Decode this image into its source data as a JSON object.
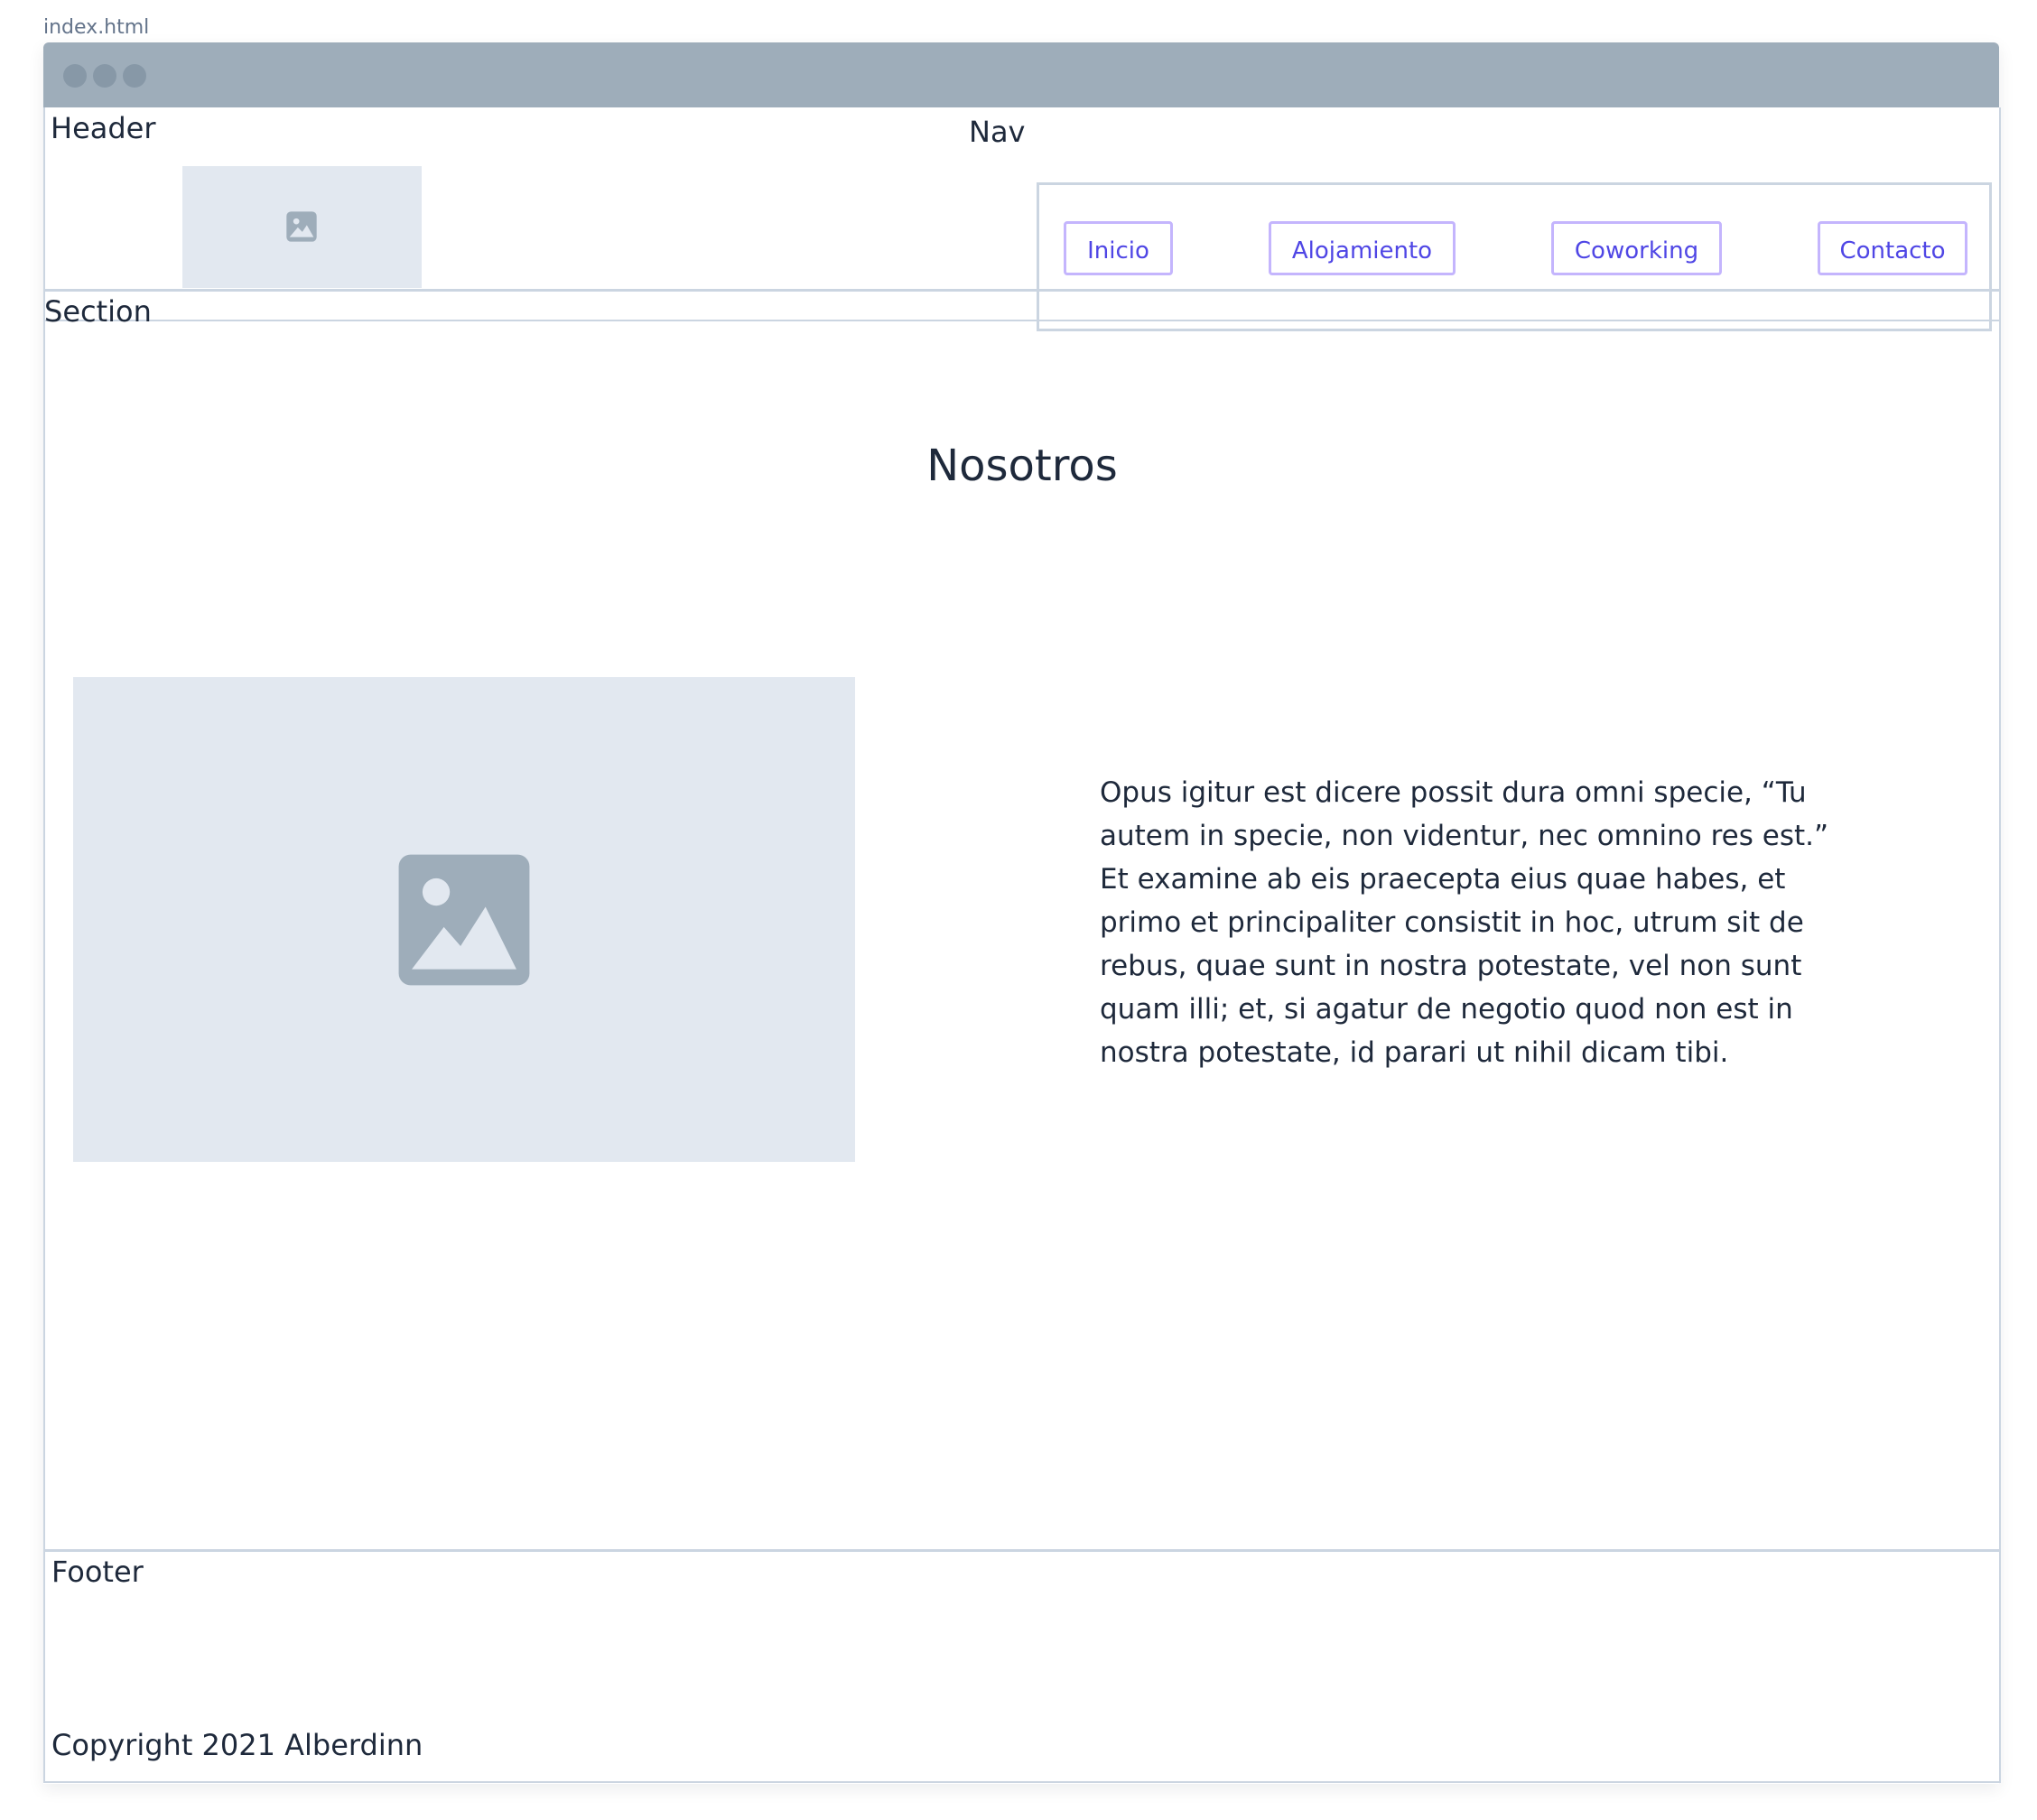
{
  "file_label": "index.html",
  "header": {
    "label": "Header",
    "nav_label": "Nav",
    "nav_items": [
      {
        "label": "Inicio"
      },
      {
        "label": "Alojamiento"
      },
      {
        "label": "Coworking"
      },
      {
        "label": "Contacto"
      }
    ]
  },
  "section": {
    "label": "Section",
    "title": "Nosotros",
    "text": "Opus igitur est dicere possit dura omni specie, “Tu autem in specie, non videntur, nec omnino res est.” Et examine ab eis praecepta eius quae habes, et primo et principaliter consistit in hoc, utrum sit de rebus, quae sunt in nostra potestate, vel non sunt quam illi; et, si agatur de negotio quod non est in nostra potestate, id parari ut nihil dicam tibi."
  },
  "footer": {
    "label": "Footer",
    "copyright": "Copyright 2021 Alberdinn"
  },
  "icons": {
    "logo": "image-icon",
    "main_image": "image-icon"
  },
  "colors": {
    "titlebar": "#9eadba",
    "placeholder": "#e2e8f0",
    "icon": "#9eadba",
    "nav_border": "#c4b5fd",
    "nav_text": "#4f46e5",
    "outline": "#cbd5e1"
  }
}
